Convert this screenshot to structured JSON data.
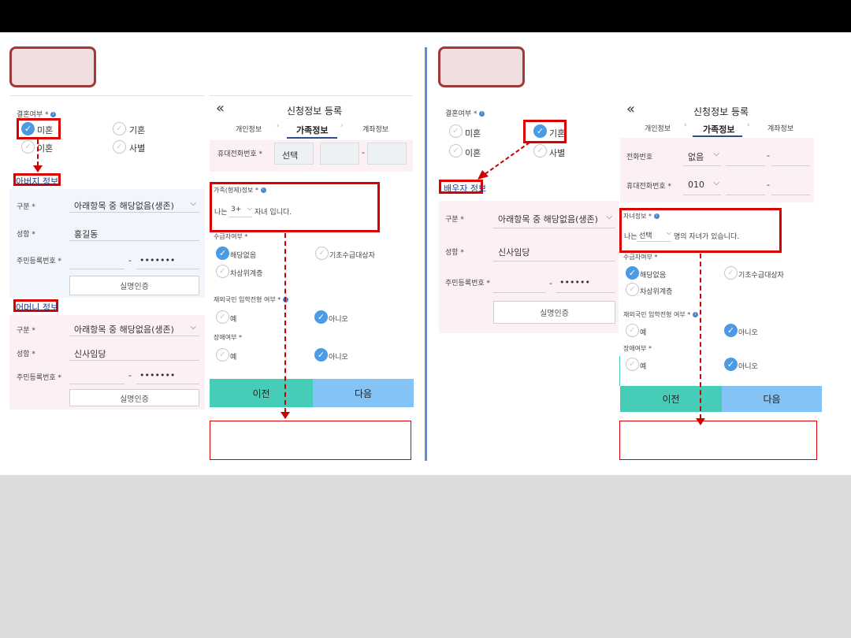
{
  "left": {
    "marital": {
      "label": "결혼여부 *",
      "options": [
        "미혼",
        "기혼",
        "이혼",
        "사별"
      ],
      "selected": "미혼"
    },
    "father": {
      "title": "아버지 정보",
      "type_label": "구분 *",
      "type_value": "아래항목 중 해당없음(생존)",
      "name_label": "성함 *",
      "name_value": "홍길동",
      "id_label": "주민등록번호 *",
      "id_dash": "-",
      "id_masked": "•••••••",
      "verify_label": "실명인증"
    },
    "mother": {
      "title": "어머니 정보",
      "type_label": "구분 *",
      "type_value": "아래항목 중 해당없음(생존)",
      "name_label": "성함 *",
      "name_value": "신사임당",
      "id_label": "주민등록번호 *",
      "id_dash": "-",
      "id_masked": "•••••••",
      "verify_label": "실명인증"
    },
    "form": {
      "back_icon": "«",
      "title": "신청정보 등록",
      "tabs": [
        "개인정보",
        "가족정보",
        "계좌정보"
      ],
      "phone_label": "휴대전화번호 *",
      "phone_select": "선택",
      "phone_dash": "-",
      "family_label": "가족(형제)정보 *",
      "family_prefix": "나는",
      "family_count": "3+",
      "family_suffix": "자녀 입니다.",
      "income_label": "수급자여부 *",
      "income_options": [
        "해당없음",
        "기초수급대상자",
        "차상위계층"
      ],
      "overseas_label": "재외국민 입학전형 여부 *",
      "overseas_options": [
        "예",
        "아니오"
      ],
      "disability_label": "장애여부 *",
      "disability_options": [
        "예",
        "아니오"
      ],
      "prev_button": "이전",
      "next_button": "다음"
    }
  },
  "right": {
    "marital": {
      "label": "결혼여부 *",
      "options": [
        "미혼",
        "기혼",
        "이혼",
        "사별"
      ],
      "selected": "기혼"
    },
    "spouse": {
      "title": "배우자 정보",
      "type_label": "구분 *",
      "type_value": "아래항목 중 해당없음(생존)",
      "name_label": "성함 *",
      "name_value": "신사임당",
      "id_label": "주민등록번호 *",
      "id_dash": "-",
      "id_masked": "••••••",
      "verify_label": "실명인증"
    },
    "form": {
      "back_icon": "«",
      "title": "신청정보 등록",
      "tabs": [
        "개인정보",
        "가족정보",
        "계좌정보"
      ],
      "tel_label": "전화번호",
      "tel_select": "없음",
      "tel_dash": "-",
      "phone_label": "휴대전화번호 *",
      "phone_select": "010",
      "phone_dash": "-",
      "children_label": "자녀정보 *",
      "children_prefix": "나는",
      "children_select": "선택",
      "children_suffix": "명의 자녀가 있습니다.",
      "income_label": "수급자여부 *",
      "income_options": [
        "해당없음",
        "기초수급대상자",
        "차상위계층"
      ],
      "overseas_label": "재외국민 입학전형 여부 *",
      "overseas_options": [
        "예",
        "아니오"
      ],
      "disability_label": "장애여부 *",
      "disability_options": [
        "예",
        "아니오"
      ],
      "prev_button": "이전",
      "next_button": "다음"
    }
  },
  "colors": {
    "accent_red": "#d00000",
    "radio_blue": "#4a9be3",
    "prev_green": "#46cdb8",
    "next_blue": "#84c3f5"
  }
}
